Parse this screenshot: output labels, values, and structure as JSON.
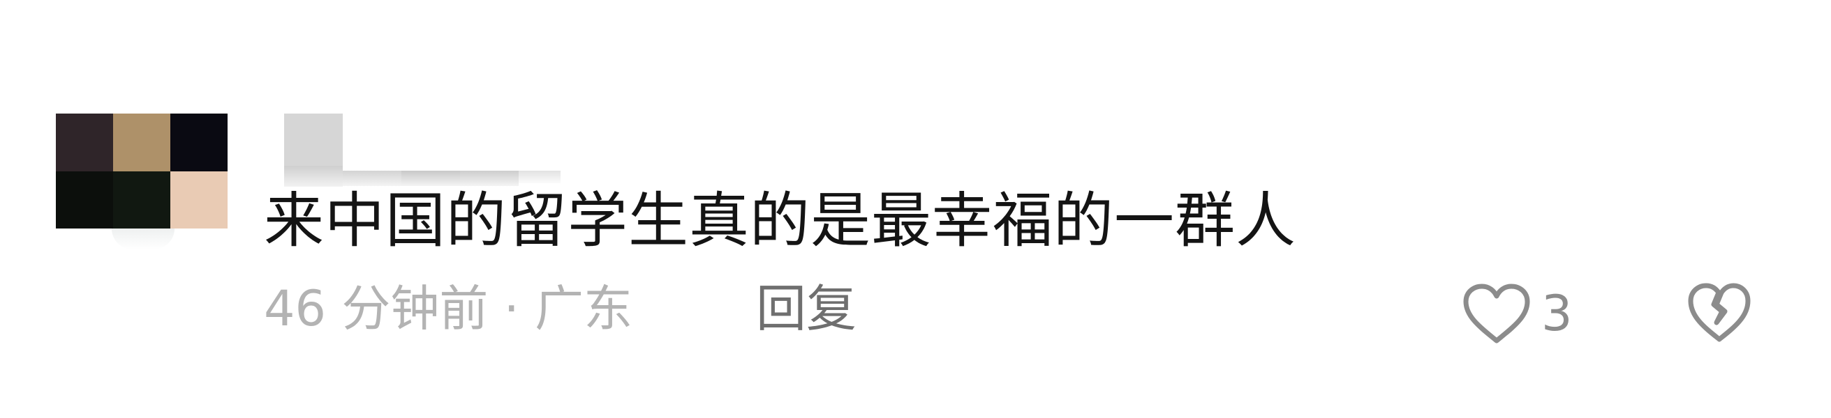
{
  "comment": {
    "text": "来中国的留学生真的是最幸福的一群人",
    "meta": "46 分钟前 · 广东",
    "reply_label": "回复",
    "like_count": "3",
    "icons": {
      "like": "heart-outline-icon",
      "dislike": "broken-heart-icon"
    },
    "colors": {
      "text": "#141414",
      "meta": "#b3b3b3",
      "reply": "#6f6f6f",
      "icon": "#8c8c8c"
    }
  }
}
